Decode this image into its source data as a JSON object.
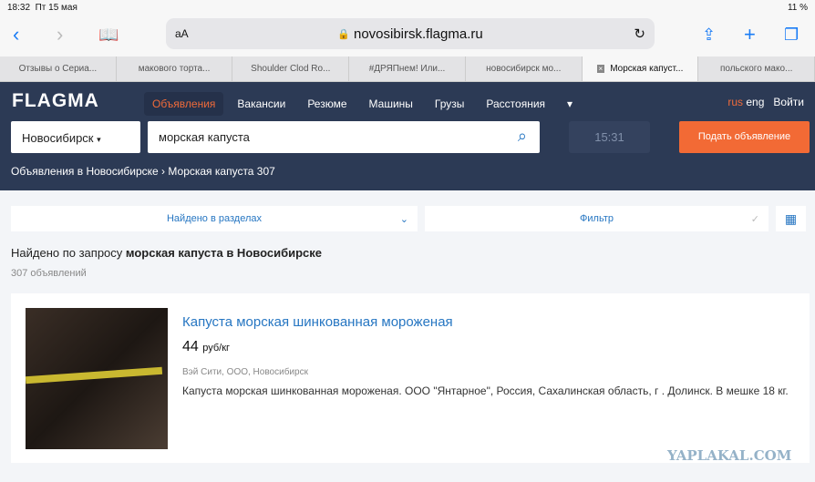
{
  "status": {
    "time": "18:32",
    "date": "Пт 15 мая",
    "battery": "11 %"
  },
  "browser": {
    "text_size": "aA",
    "url": "novosibirsk.flagma.ru"
  },
  "tabs": [
    "Отзывы о Сериа...",
    "макового торта...",
    "Shoulder Clod Ro...",
    "#ДРЯПнем! Или...",
    "новосибирск мо...",
    "Морская капуст...",
    "польского мако..."
  ],
  "header": {
    "logo": "FLAGMA",
    "nav": [
      "Объявления",
      "Вакансии",
      "Резюме",
      "Машины",
      "Грузы",
      "Расстояния"
    ],
    "lang_rus": "rus",
    "lang_eng": "eng",
    "login": "Войти",
    "city": "Новосибирск",
    "search_value": "морская капуста",
    "time": "15:31",
    "post_button": "Подать объявление",
    "breadcrumb_1": "Объявления в Новосибирске",
    "breadcrumb_2": "Морская капуста 307"
  },
  "filters": {
    "sections": "Найдено в разделах",
    "filter": "Фильтр"
  },
  "results": {
    "found_prefix": "Найдено по запросу ",
    "found_query": "морская капуста в Новосибирске",
    "count": "307 объявлений"
  },
  "listing": {
    "title": "Капуста морская шинкованная мороженая",
    "price": "44",
    "unit": "руб/кг",
    "seller": "Вэй Сити, ООО, Новосибирск",
    "description": "Капуста морская шинкованная мороженая. ООО \"Янтарное\", Россия, Сахалинская область, г . Долинск. В мешке 18 кг."
  },
  "watermark": "YAPLAKAL.COM"
}
